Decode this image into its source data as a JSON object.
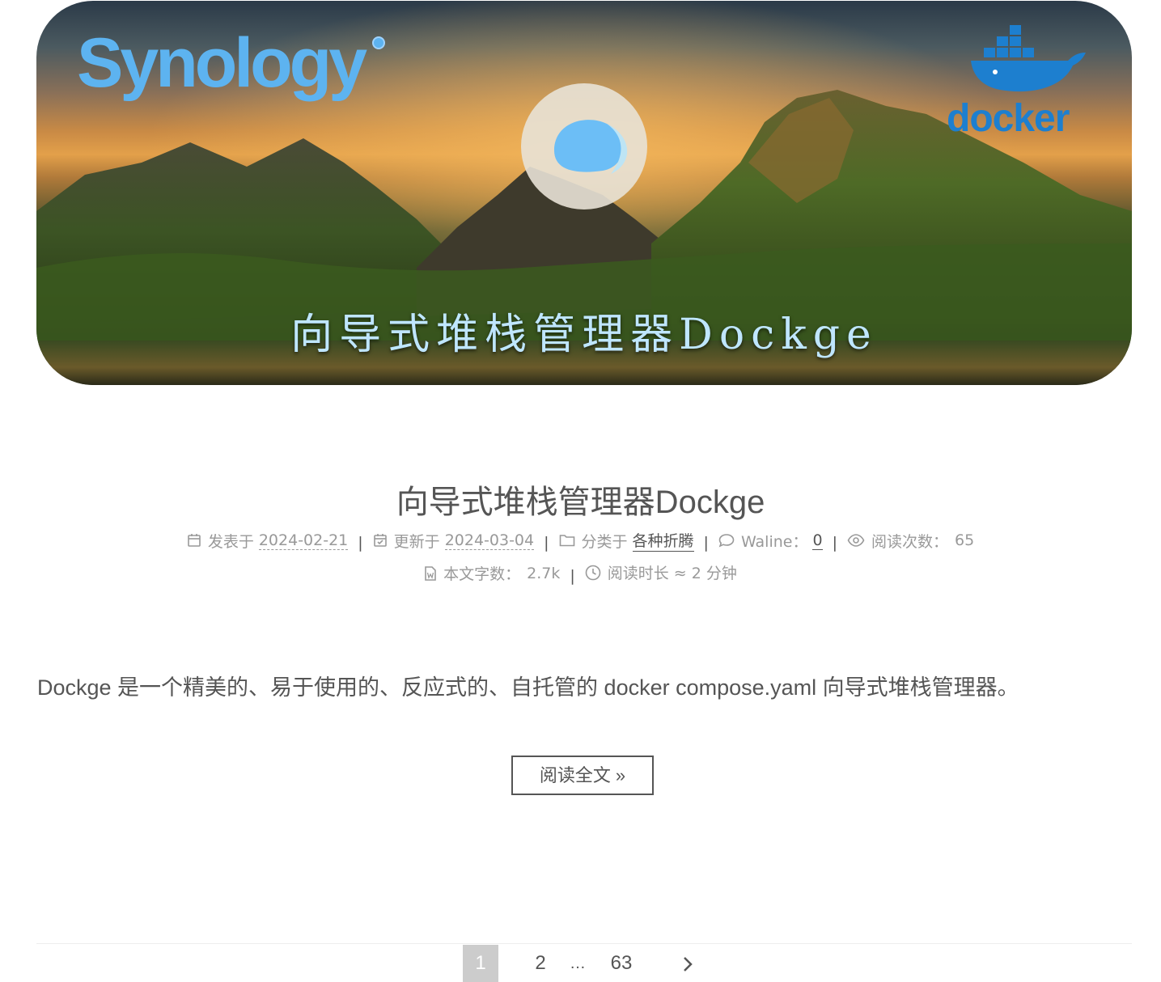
{
  "banner": {
    "brand_left": "Synology",
    "brand_right": "docker",
    "title": "向导式堆栈管理器Dockge"
  },
  "post": {
    "title": "向导式堆栈管理器Dockge",
    "meta": {
      "posted_label": "发表于",
      "posted_date": "2024-02-21",
      "updated_label": "更新于",
      "updated_date": "2024-03-04",
      "category_label": "分类于",
      "category": "各种折腾",
      "comments_label": "Waline：",
      "comments_count": "0",
      "views_label": "阅读次数：",
      "views_count": "65",
      "words_label": "本文字数：",
      "words_count": "2.7k",
      "reading_time": "阅读时长 ≈ 2 分钟"
    },
    "excerpt": "Dockge 是一个精美的、易于使用的、反应式的、自托管的 docker compose.yaml 向导式堆栈管理器。",
    "read_more": "阅读全文 »"
  },
  "pagination": {
    "current": "1",
    "pages": [
      "2",
      "…",
      "63"
    ],
    "next_icon": "chevron-right-icon"
  }
}
